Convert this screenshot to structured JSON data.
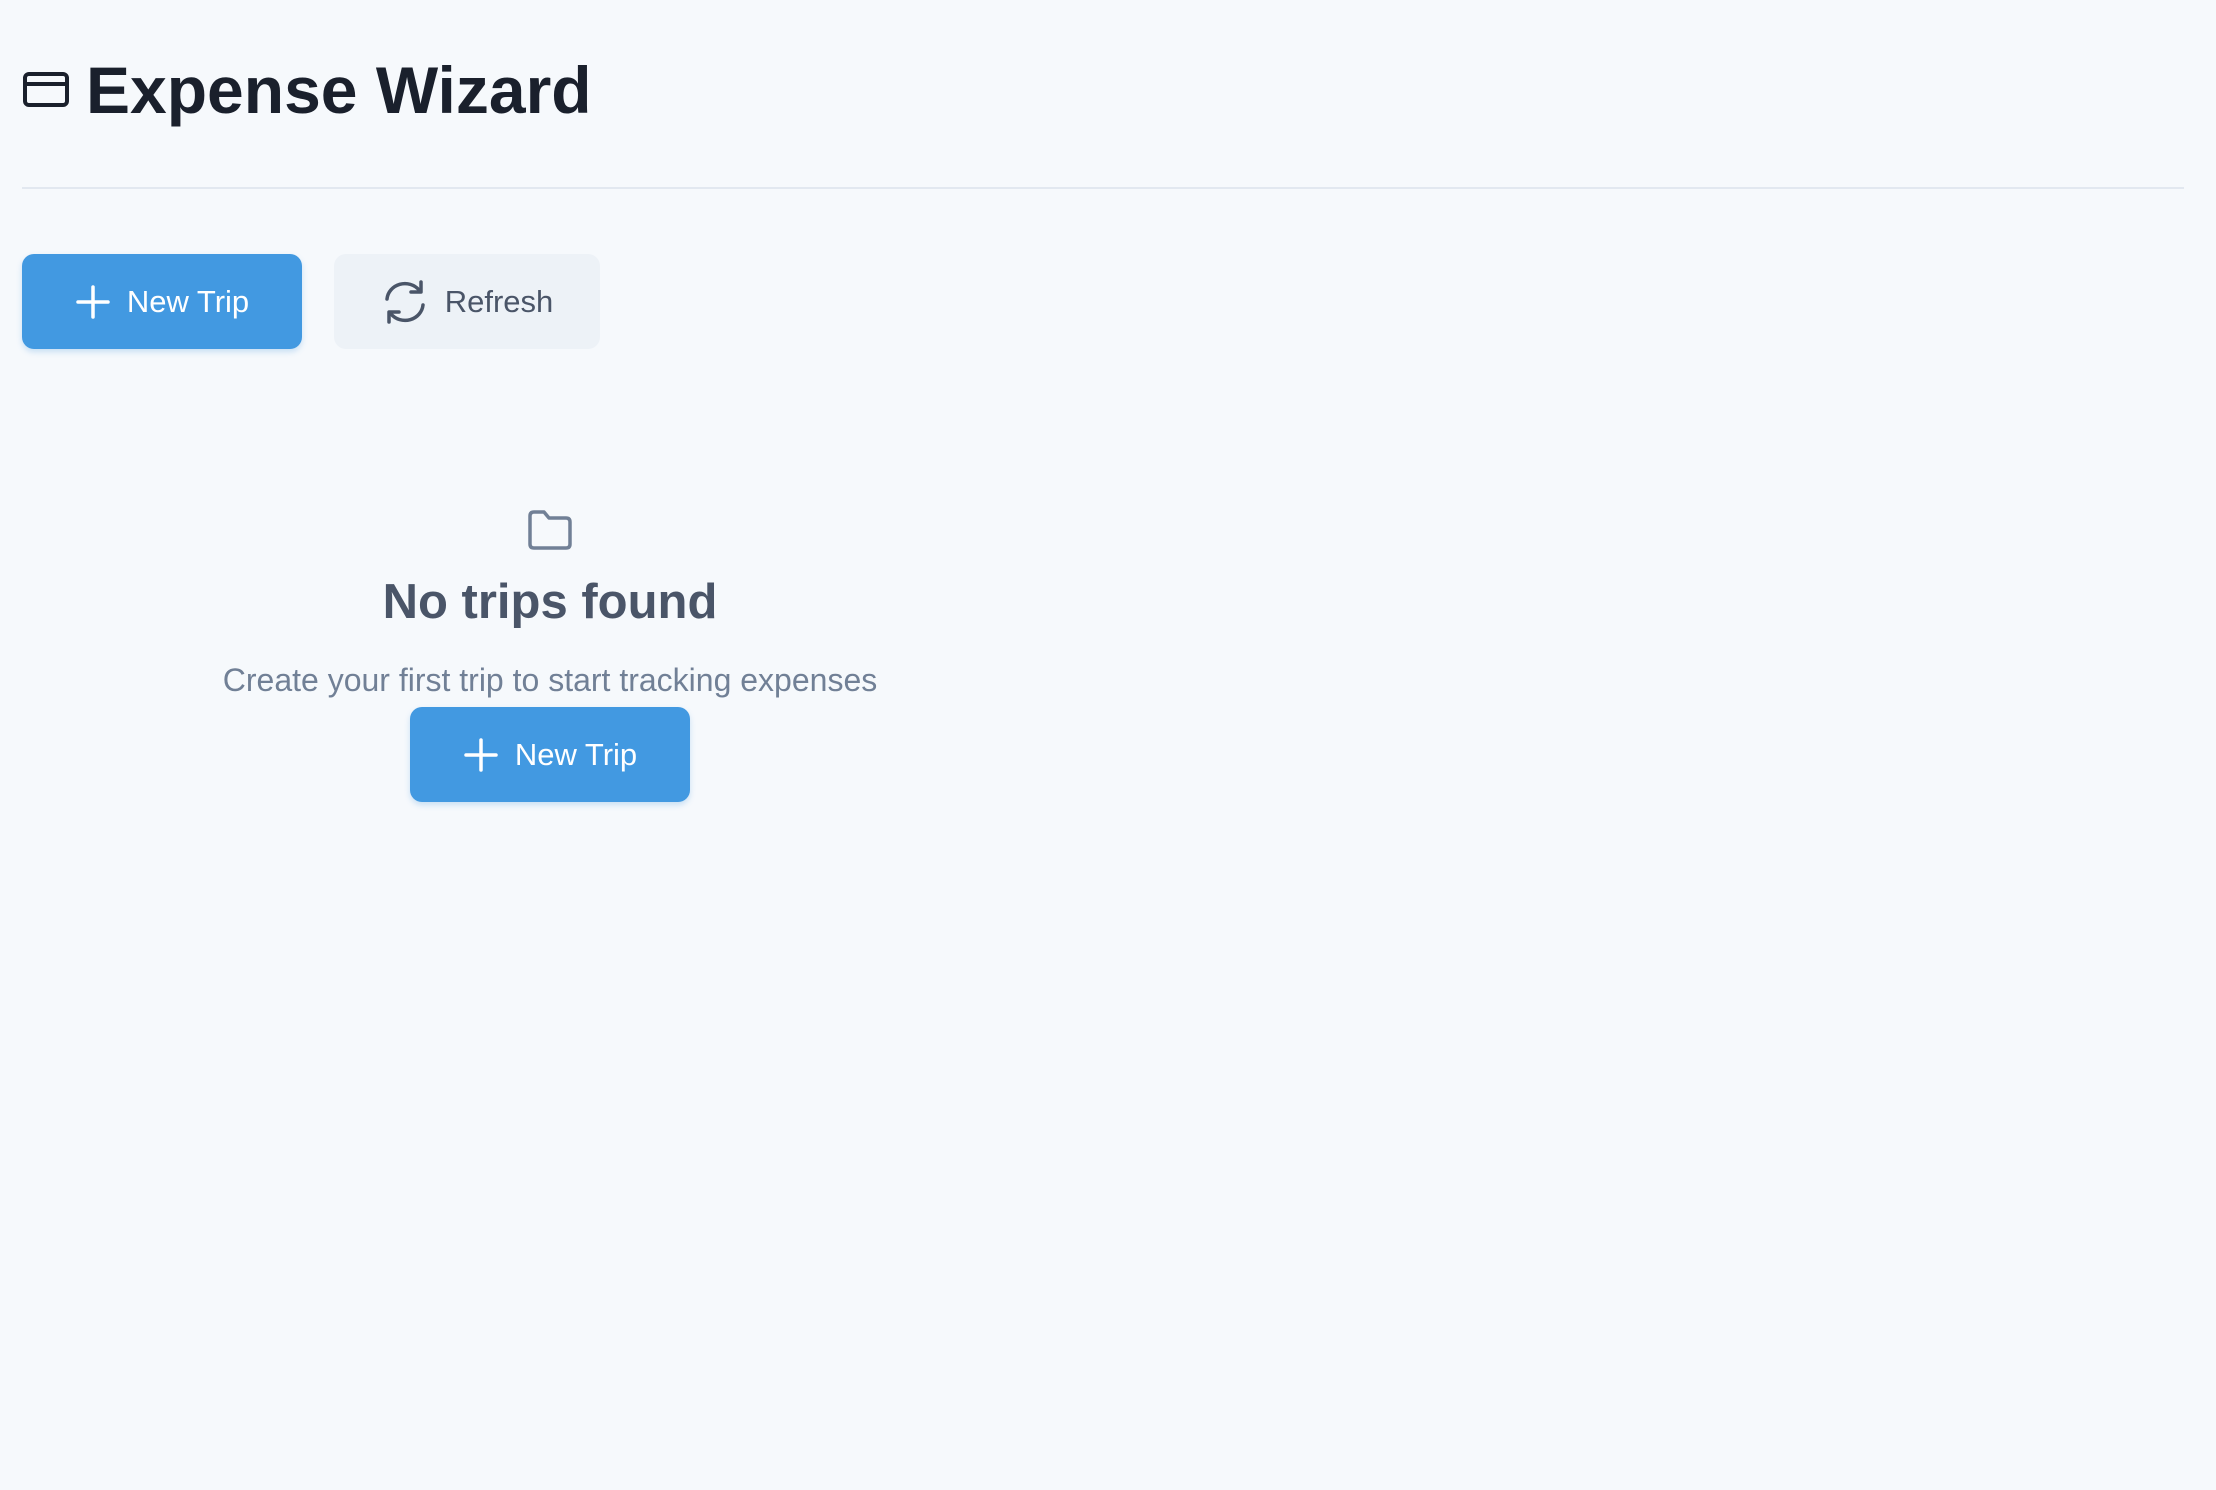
{
  "header": {
    "title": "Expense Wizard",
    "icon": "credit-card-icon"
  },
  "toolbar": {
    "new_trip_label": "New Trip",
    "new_trip_icon": "plus-icon",
    "refresh_label": "Refresh",
    "refresh_icon": "refresh-icon"
  },
  "empty_state": {
    "icon": "folder-icon",
    "title": "No trips found",
    "message": "Create your first trip to start tracking expenses",
    "button_label": "New Trip",
    "button_icon": "plus-icon"
  },
  "colors": {
    "background": "#f6f9fc",
    "primary": "#4299e1",
    "secondary_bg": "#edf2f7",
    "heading": "#1a202c",
    "muted_text": "#718096",
    "divider": "#e2e8f0"
  }
}
